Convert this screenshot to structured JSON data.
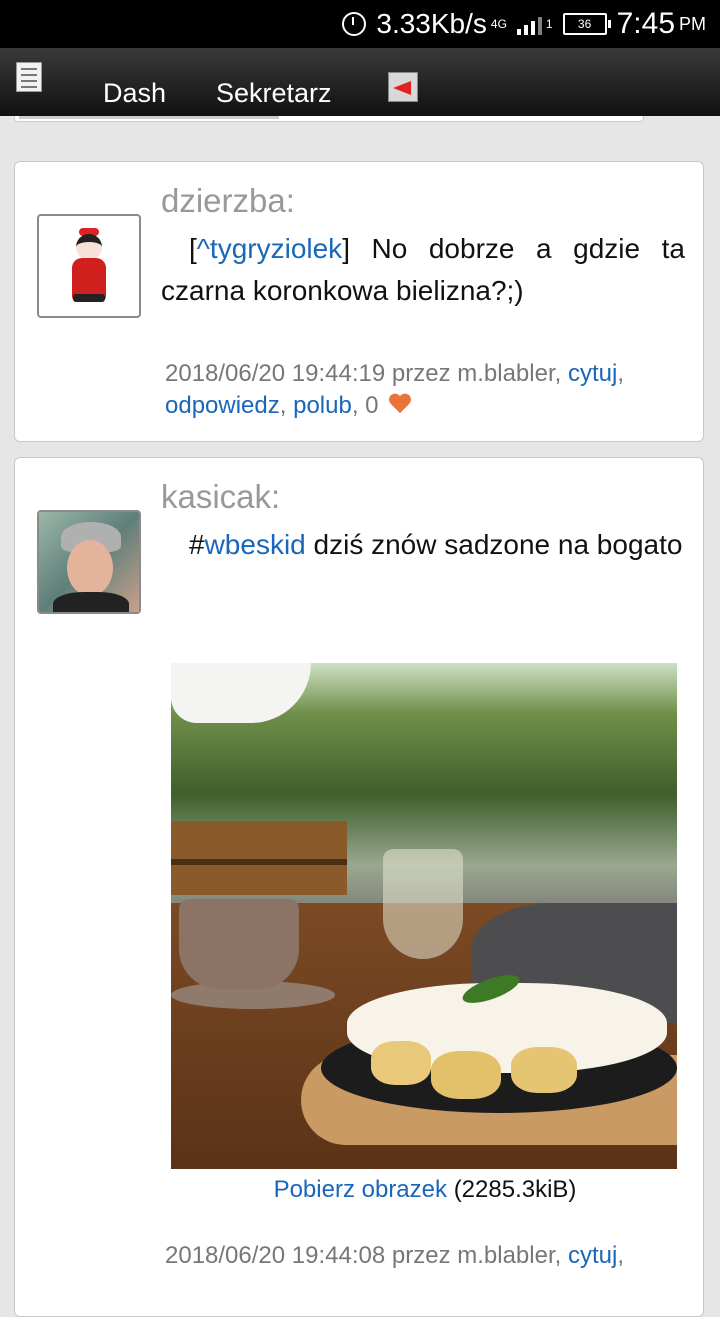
{
  "status_bar": {
    "speed": "3.33Kb/s",
    "network": "4G",
    "sim": "1",
    "battery": "36",
    "time": "7:45",
    "ampm": "PM"
  },
  "nav": {
    "dash_label": "Dash",
    "sekretarz_label": "Sekretarz"
  },
  "posts": [
    {
      "username": "dzierzba:",
      "text_prefix": "[",
      "mention": "^tygryziolek",
      "text_rest": "] No dobrze a gdzie ta czarna koronkowa bielizna?;)",
      "timestamp": "2018/06/20 19:44:19 przez m.blabler,",
      "cytuj": "cytuj",
      "odpowiedz": "odpowiedz",
      "polub": "polub",
      "likes": "0"
    },
    {
      "username": "kasicak:",
      "text_prefix": "#",
      "hashtag": "wbeskid",
      "text_rest": " dziś znów sadzone na bogato",
      "download_link": "Pobierz obrazek",
      "download_size": "(2285.3kiB)",
      "timestamp": "2018/06/20 19:44:08 przez m.blabler,",
      "cytuj": "cytuj"
    }
  ]
}
